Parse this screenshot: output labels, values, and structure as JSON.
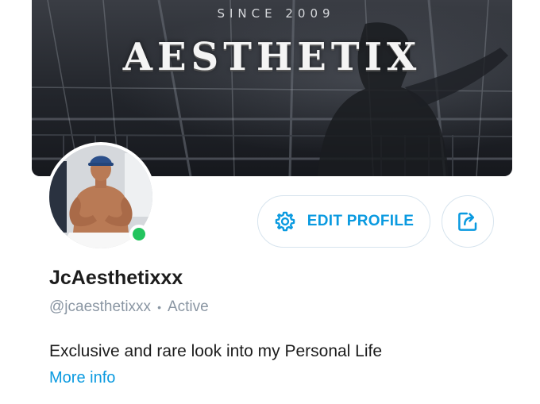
{
  "banner": {
    "since_text": "SINCE 2009",
    "title": "AESTHETIX"
  },
  "profile": {
    "display_name": "JcAesthetixxx",
    "handle": "@jcaesthetixxx",
    "separator": "•",
    "status": "Active",
    "online": true,
    "bio": "Exclusive and rare look into my Personal Life",
    "more_info_label": "More info"
  },
  "actions": {
    "edit_profile_label": "EDIT PROFILE",
    "edit_profile_icon": "gear-icon",
    "share_icon": "share-icon"
  },
  "colors": {
    "accent": "#0a9ae0",
    "online": "#23c45e",
    "muted_text": "#8a96a3",
    "button_border": "#d7e4ee"
  }
}
